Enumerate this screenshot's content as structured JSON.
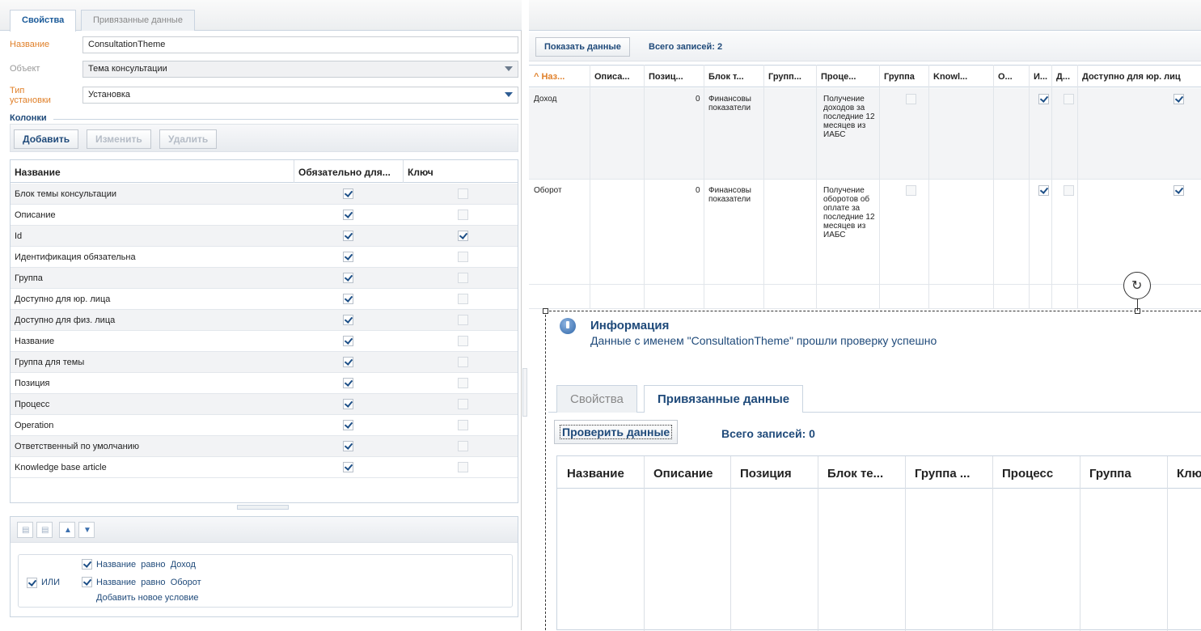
{
  "left": {
    "tabs": [
      "Свойства",
      "Привязанные данные"
    ],
    "fields": [
      {
        "label": "Название",
        "value": "ConsultationTheme"
      },
      {
        "label": "Объект",
        "value": "Тема консультации"
      },
      {
        "label": "Тип установки",
        "value": "Установка"
      }
    ],
    "section_title": "Колонки",
    "buttons": {
      "add": "Добавить",
      "edit": "Изменить",
      "delete": "Удалить"
    },
    "grid_headers": {
      "name": "Название",
      "required": "Обязательно для...",
      "key": "Ключ"
    },
    "rows": [
      {
        "name": "Блок темы консультации",
        "required": true,
        "key": false
      },
      {
        "name": "Описание",
        "required": true,
        "key": false
      },
      {
        "name": "Id",
        "required": true,
        "key": true
      },
      {
        "name": "Идентификация обязательна",
        "required": true,
        "key": false
      },
      {
        "name": "Группа",
        "required": true,
        "key": false
      },
      {
        "name": "Доступно для юр. лица",
        "required": true,
        "key": false
      },
      {
        "name": "Доступно для физ. лица",
        "required": true,
        "key": false
      },
      {
        "name": "Название",
        "required": true,
        "key": false
      },
      {
        "name": "Группа для темы",
        "required": true,
        "key": false
      },
      {
        "name": "Позиция",
        "required": true,
        "key": false
      },
      {
        "name": "Процесс",
        "required": true,
        "key": false
      },
      {
        "name": "Operation",
        "required": true,
        "key": false
      },
      {
        "name": "Ответственный по умолчанию",
        "required": true,
        "key": false
      },
      {
        "name": "Knowledge base article",
        "required": true,
        "key": false
      }
    ],
    "filter": {
      "operator": "ИЛИ",
      "conditions": [
        {
          "field": "Название",
          "op": "равно",
          "value": "Доход"
        },
        {
          "field": "Название",
          "op": "равно",
          "value": "Оборот"
        }
      ],
      "add_condition": "Добавить новое условие"
    }
  },
  "right": {
    "show_data": "Показать данные",
    "count": "Всего записей: 2",
    "headers": [
      "Наз...",
      "Описа...",
      "Позиц...",
      "Блок т...",
      "Групп...",
      "Проце...",
      "Группа",
      "Knowl...",
      "О...",
      "И...",
      "Д...",
      "Доступно для юр. лиц"
    ],
    "rows": [
      {
        "name": "Доход",
        "pos": "0",
        "block": "Финансовы показатели",
        "process": "Получение доходов за последние 12 месяцев из ИАБС"
      },
      {
        "name": "Оборот",
        "pos": "0",
        "block": "Финансовы показатели",
        "process": "Получение оборотов об оплате за последние 12 месяцев из ИАБС"
      }
    ]
  },
  "info": {
    "title": "Информация",
    "message": "Данные с именем \"ConsultationTheme\" прошли проверку успешно",
    "tabs": [
      "Свойства",
      "Привязанные данные"
    ],
    "check_button": "Проверить данные",
    "count": "Всего записей: 0",
    "headers": [
      "Название",
      "Описание",
      "Позиция",
      "Блок те...",
      "Группа ...",
      "Процесс",
      "Группа",
      "Клю"
    ]
  }
}
